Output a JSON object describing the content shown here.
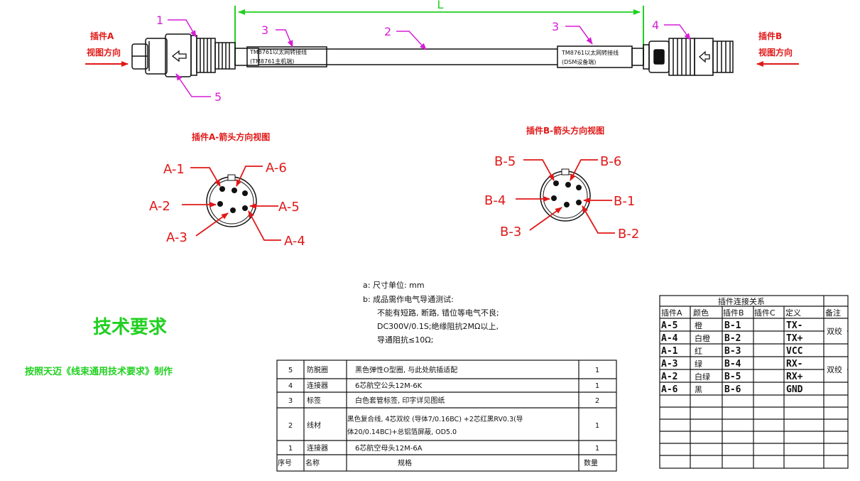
{
  "header": {
    "plug_a_title": "插件A",
    "plug_a_view": "视图方向",
    "plug_b_title": "插件B",
    "plug_b_view": "视图方向",
    "length_symbol": "L"
  },
  "callouts": {
    "c1": "1",
    "c2": "2",
    "c3_left": "3",
    "c3_right": "3",
    "c4": "4",
    "c5": "5"
  },
  "labels": {
    "left_line1": "TM8761以太网转接线",
    "left_line2": "(TM8761主机端)",
    "right_line1": "TM8761以太网转接线",
    "right_line2": "(DSM设备端)"
  },
  "views": {
    "a_title": "插件A-箭头方向视图",
    "b_title": "插件B-箭头方向视图",
    "a_pins": [
      "A-1",
      "A-2",
      "A-3",
      "A-4",
      "A-5",
      "A-6"
    ],
    "b_pins": [
      "B-1",
      "B-2",
      "B-3",
      "B-4",
      "B-5",
      "B-6"
    ]
  },
  "notes": {
    "a": "a: 尺寸单位: mm",
    "b": "b: 成品需作电气导通测试:",
    "b1": "不能有短路, 断路, 错位等电气不良;",
    "b2": "DC300V/0.1S;绝缘阻抗2MΩ以上,",
    "b3": "导通阻抗≤10Ω;"
  },
  "tech": {
    "title": "技术要求",
    "subtitle": "按照天迈《线束通用技术要求》制作"
  },
  "bom": {
    "header": {
      "no": "序号",
      "name": "名称",
      "spec": "规格",
      "qty": "数量"
    },
    "rows": [
      {
        "no": "5",
        "name": "防脱圈",
        "spec1": "黑色弹性O型圈, 与此处航插适配",
        "spec2": "",
        "qty": "1"
      },
      {
        "no": "4",
        "name": "连接器",
        "spec1": "6芯航空公头12M-6K",
        "spec2": "",
        "qty": "1"
      },
      {
        "no": "3",
        "name": "标签",
        "spec1": "白色套管标签, 印字详见图纸",
        "spec2": "",
        "qty": "2"
      },
      {
        "no": "2",
        "name": "线材",
        "spec1": "黑色复合线, 4芯双绞 (导体7/0.16BC) +2芯红黑RV0.3(导",
        "spec2": "体20/0.14BC)+总铝箔屏蔽, OD5.0",
        "qty": "1"
      },
      {
        "no": "1",
        "name": "连接器",
        "spec1": "6芯航空母头12M-6A",
        "spec2": "",
        "qty": "1"
      }
    ]
  },
  "conn_table": {
    "title": "插件连接关系",
    "headers": [
      "插件A",
      "颜色",
      "插件B",
      "插件C",
      "定义",
      "备注"
    ],
    "rows": [
      {
        "a": "A-5",
        "color": "橙",
        "b": "B-1",
        "c": "",
        "def": "TX-"
      },
      {
        "a": "A-4",
        "color": "白橙",
        "b": "B-2",
        "c": "",
        "def": "TX+"
      },
      {
        "a": "A-1",
        "color": "红",
        "b": "B-3",
        "c": "",
        "def": "VCC"
      },
      {
        "a": "A-3",
        "color": "绿",
        "b": "B-4",
        "c": "",
        "def": "RX-"
      },
      {
        "a": "A-2",
        "color": "白绿",
        "b": "B-5",
        "c": "",
        "def": "RX+"
      },
      {
        "a": "A-6",
        "color": "黑",
        "b": "B-6",
        "c": "",
        "def": "GND"
      }
    ],
    "notes": [
      "双绞",
      "双绞"
    ]
  },
  "colors": {
    "red": "#e01818",
    "magenta": "#d61fd6",
    "green": "#20d020",
    "line": "#111111"
  }
}
